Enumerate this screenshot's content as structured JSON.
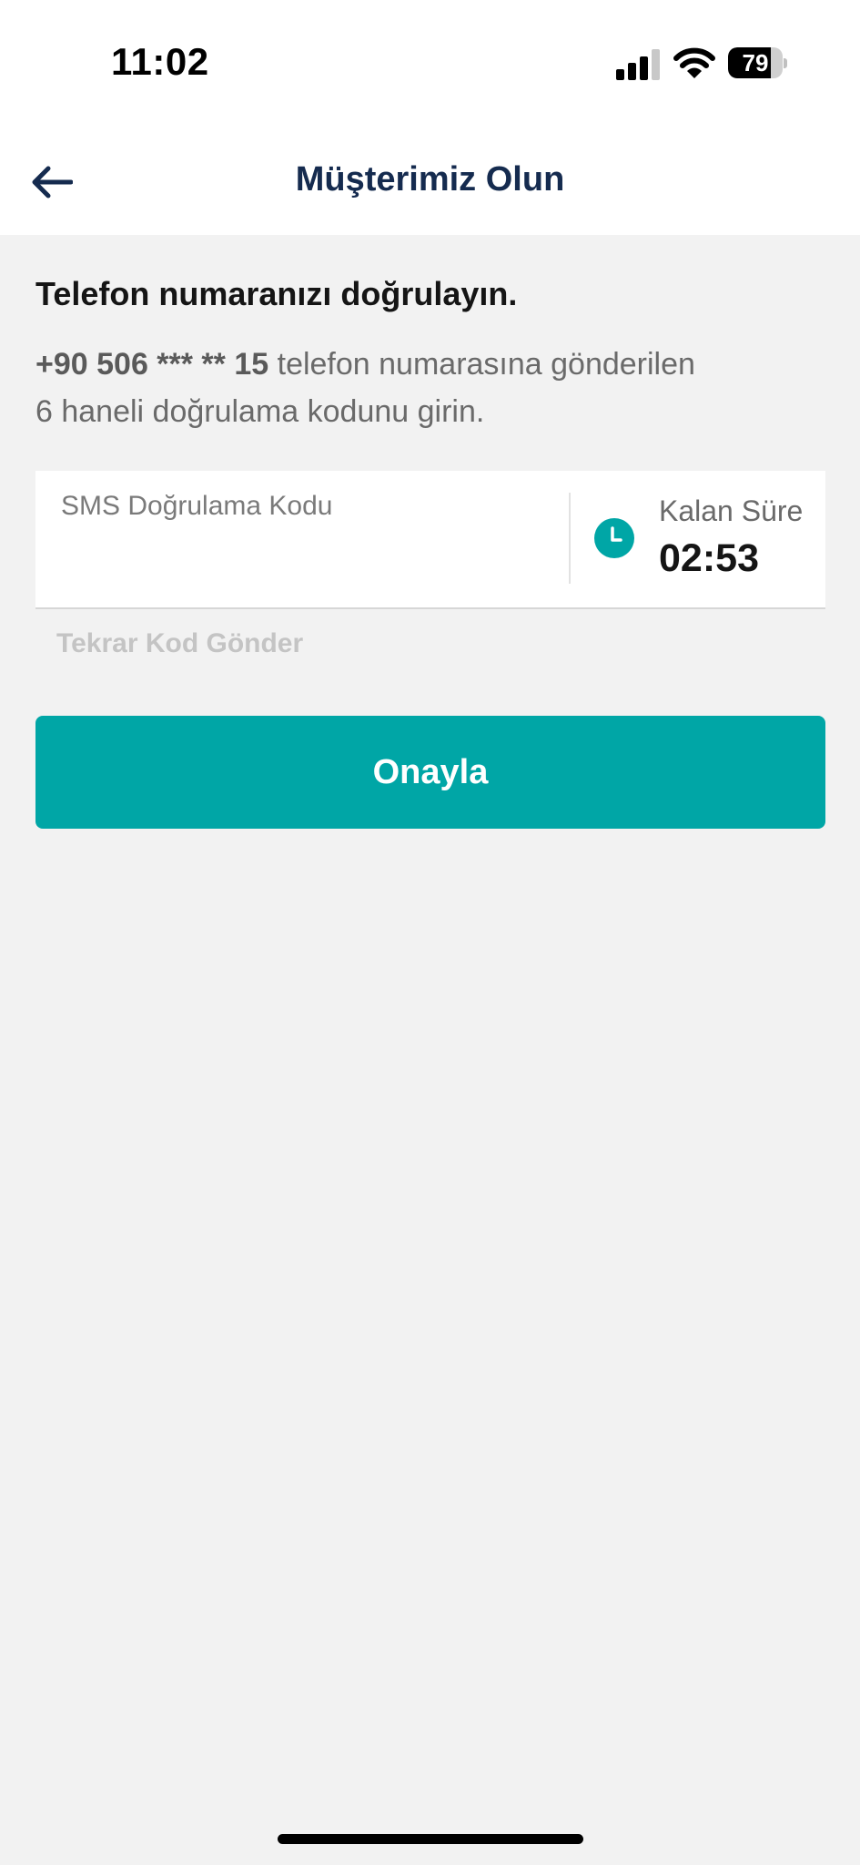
{
  "status_bar": {
    "time": "11:02",
    "battery_level": "79",
    "battery_fraction": 0.79
  },
  "header": {
    "back_icon": "arrow-left-icon",
    "title": "Müşterimiz Olun"
  },
  "verification": {
    "heading": "Telefon numaranızı doğrulayın.",
    "phone_masked": "+90 506 *** ** 15",
    "description_rest_line1": " telefon numarasına gönderilen",
    "description_line2": "6 haneli doğrulama kodunu girin."
  },
  "code_field": {
    "label": "SMS Doğrulama Kodu",
    "value": "",
    "timer_icon": "clock-icon",
    "timer_label": "Kalan Süre",
    "timer_value": "02:53"
  },
  "resend_label": "Tekrar Kod Gönder",
  "confirm_label": "Onayla",
  "colors": {
    "accent": "#00a6a6",
    "title": "#152b4f",
    "disabled_text": "#c4c4c4"
  }
}
